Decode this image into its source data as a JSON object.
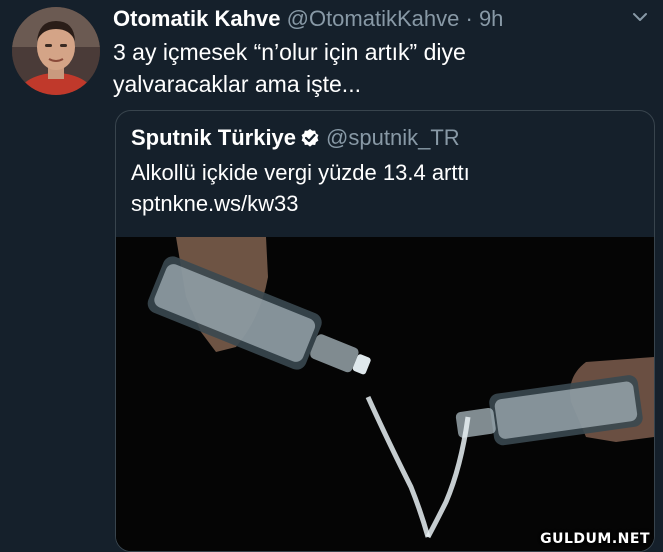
{
  "tweet": {
    "author_name": "Otomatik Kahve",
    "handle": "@OtomatikKahve",
    "separator": "·",
    "time": "9h",
    "text": "3 ay içmesek “n’olur için artık” diye yalvaracaklar ama işte...",
    "menu_icon": "chevron-down-icon"
  },
  "quoted": {
    "author_name": "Sputnik Türkiye",
    "verified_icon": "verified-badge-icon",
    "handle": "@sputnik_TR",
    "text_line1": "Alkollü içkide vergi yüzde 13.4 arttı",
    "text_line2": "sptnkne.ws/kw33"
  },
  "watermark": "GULDUM.NET",
  "colors": {
    "background": "#15202b",
    "secondary_text": "#8899a6",
    "border": "#38444d",
    "verified": "#1da1f2"
  }
}
